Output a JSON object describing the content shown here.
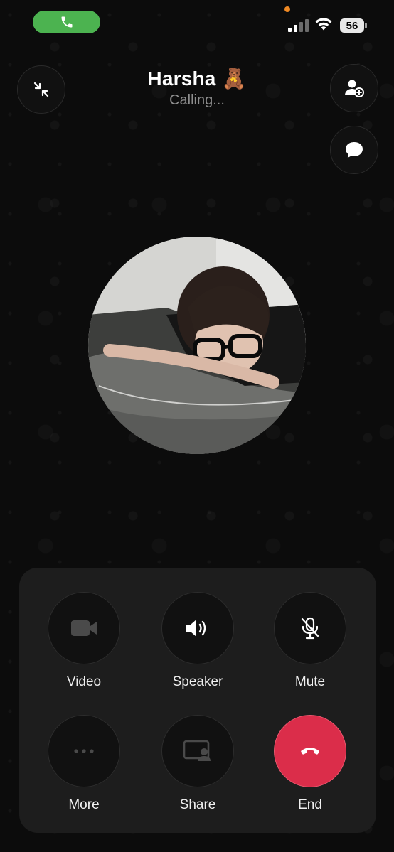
{
  "status_bar": {
    "battery": "56",
    "call_indicator": "phone-icon",
    "accent_green": "#4cb350",
    "privacy_dot_color": "#f08a24"
  },
  "header": {
    "caller_name": "Harsha 🧸",
    "call_status": "Calling..."
  },
  "header_buttons": {
    "minimize": "minimize-icon",
    "add_participant": "add-person-icon",
    "message": "chat-bubble-icon"
  },
  "controls": [
    {
      "label": "Video",
      "icon": "video-camera-icon"
    },
    {
      "label": "Speaker",
      "icon": "speaker-icon"
    },
    {
      "label": "Mute",
      "icon": "mic-off-icon"
    },
    {
      "label": "More",
      "icon": "more-dots-icon"
    },
    {
      "label": "Share",
      "icon": "screen-share-icon"
    },
    {
      "label": "End",
      "icon": "end-call-icon"
    }
  ],
  "colors": {
    "end_call": "#db2d4a",
    "panel": "#1d1d1d"
  }
}
